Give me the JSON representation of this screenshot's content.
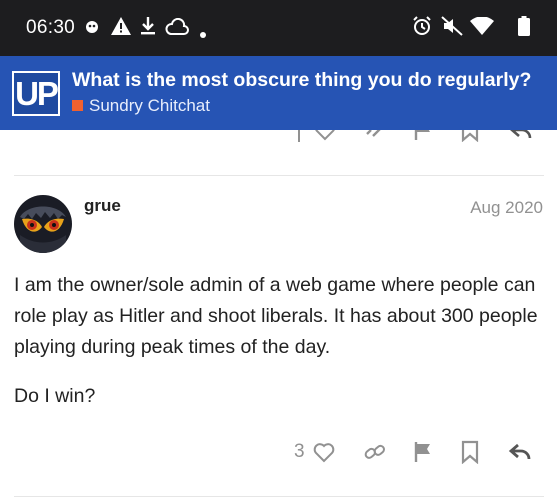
{
  "status_bar": {
    "time": "06:30",
    "icons": [
      "notification-dot-icon",
      "warning-icon",
      "download-icon",
      "cloud-icon",
      "dot-icon",
      "alarm-icon",
      "mute-icon",
      "wifi-icon",
      "battery-icon"
    ]
  },
  "header": {
    "logo_text": "UP",
    "topic_title": "What is the most obscure thing you do regularly?",
    "category": "Sundry Chitchat",
    "category_color": "#f0612f",
    "background": "#2654b4"
  },
  "post": {
    "username": "grue",
    "date": "Aug 2020",
    "paragraphs": [
      "I am the owner/sole admin of a web game where people can role play as Hitler and shoot liberals. It has about 300 people playing during peak times of the day.",
      "Do I win?"
    ],
    "like_count": "3",
    "actions": [
      "heart-icon",
      "link-icon",
      "flag-icon",
      "bookmark-icon",
      "reply-icon"
    ]
  }
}
